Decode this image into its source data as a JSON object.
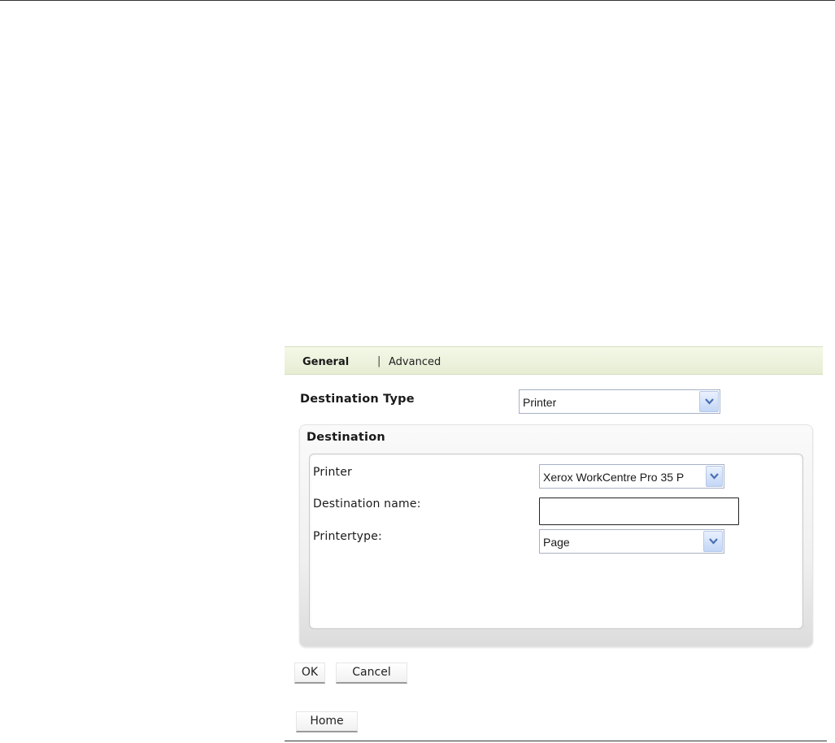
{
  "tabs": {
    "general_label": "General",
    "separator": "|",
    "advanced_label": "Advanced"
  },
  "form": {
    "destination_type_label": "Destination Type",
    "destination_type_value": "Printer",
    "destination_group_label": "Destination",
    "printer_label": "Printer",
    "printer_value": "Xerox WorkCentre Pro 35 P",
    "destination_name_label": "Destination name:",
    "destination_name_value": "",
    "printertype_label": "Printertype:",
    "printertype_value": "Page"
  },
  "buttons": {
    "ok_label": "OK",
    "cancel_label": "Cancel",
    "home_label": "Home"
  },
  "icons": {
    "dropdown": "chevron-down-icon"
  },
  "colors": {
    "tabbar_bg": "#e6edd3",
    "select_border": "#a7b1c4",
    "select_arrow": "#4a6fb5"
  }
}
